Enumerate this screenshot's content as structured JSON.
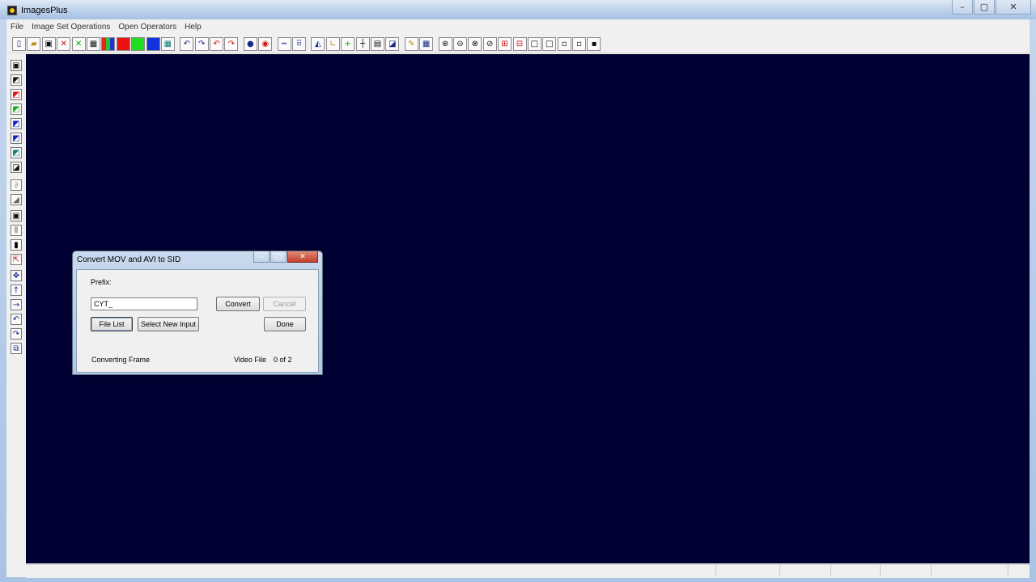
{
  "window": {
    "title": "ImagesPlus",
    "controls": {
      "minimize": "–",
      "maximize": "▢",
      "close": "✕"
    }
  },
  "menu": [
    "File",
    "Image Set Operations",
    "Open Operators",
    "Help"
  ],
  "toolbar_icons": [
    "new-file-icon",
    "open-folder-icon",
    "save-icon",
    "delete-icon",
    "clear-icon",
    "calculator-icon",
    "rgb-channels-icon",
    "red-channel-icon",
    "green-channel-icon",
    "blue-channel-icon",
    "grid-image-icon",
    "undo-icon",
    "redo-icon",
    "undo-all-icon",
    "redo-all-icon",
    "point-icon",
    "circle-point-icon",
    "dotted-line-icon",
    "dotted-grid-icon",
    "histogram-icon",
    "curves-icon",
    "plus-icon",
    "crosshair-icon",
    "grid-calc-icon",
    "image-stats-icon",
    "pencil-icon",
    "table-icon",
    "zoom-in-icon",
    "zoom-out-icon",
    "zoom-fit-icon",
    "zoom-reset-icon",
    "add-box-icon",
    "remove-box-icon",
    "large-square-icon",
    "medium-square-icon",
    "small-square-icon",
    "smaller-square-icon",
    "tiny-square-icon"
  ],
  "left_toolbar_icons": [
    "save-icon",
    "layers-icon",
    "red-layer-icon",
    "green-layer-icon",
    "blue-layer-icon",
    "channel-stack-icon",
    "combine-icon",
    "mask-icon",
    "brush-icon",
    "gradient-icon",
    "select-box-icon",
    "align-icon",
    "black-bar-icon",
    "cursor-icon",
    "move-icon",
    "up-arrow-icon",
    "right-arrow-icon",
    "undo-arrow-icon",
    "redo-arrow-icon",
    "copy-icon"
  ],
  "dialog": {
    "title": "Convert MOV and AVI to SID",
    "prefix_label": "Prefix:",
    "prefix_value": "CYT_",
    "convert_label": "Convert",
    "cancel_label": "Cancel",
    "file_list_label": "File List",
    "select_new_input_label": "Select New Input",
    "done_label": "Done",
    "status_text": "Converting Frame",
    "video_file_label": "Video File",
    "progress_text": "0 of 2",
    "controls": {
      "minimize": "–",
      "maximize": "▢",
      "close": "✕"
    }
  },
  "colors": {
    "workspace_bg": "#000033",
    "title_gradient_top": "#dce8f6",
    "title_gradient_bottom": "#a7c1e2",
    "close_button": "#c1402c"
  }
}
